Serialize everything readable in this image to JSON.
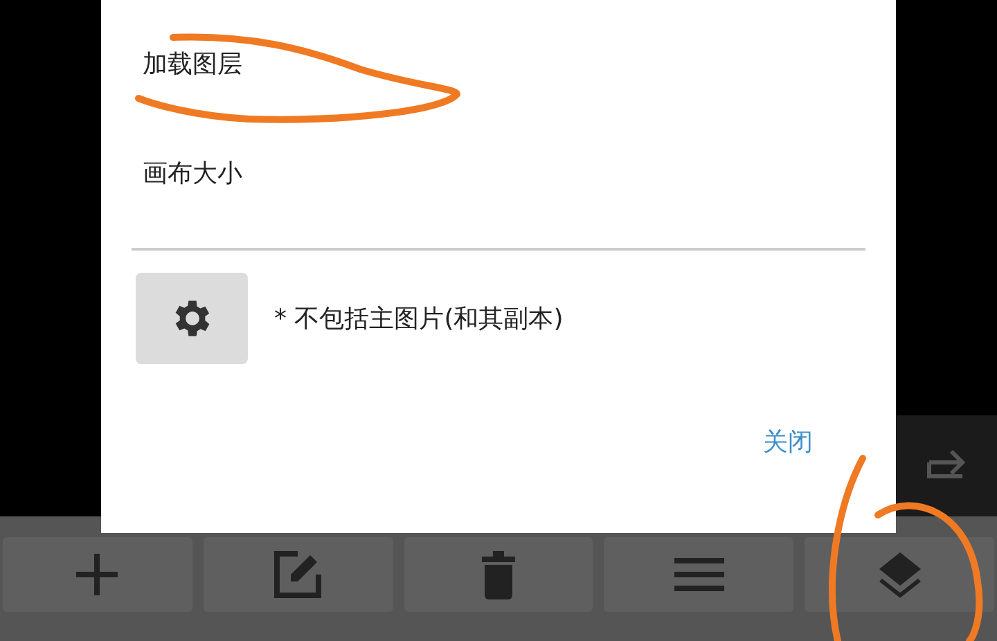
{
  "dialog": {
    "menu_items": [
      "加载图层",
      "画布大小"
    ],
    "settings_button": {
      "kind": "gear"
    },
    "note": "* 不包括主图片(和其副本)",
    "close_button": "关闭"
  },
  "side_button": {
    "kind": "redo"
  },
  "toolbar": [
    {
      "kind": "add"
    },
    {
      "kind": "edit"
    },
    {
      "kind": "delete"
    },
    {
      "kind": "menu"
    },
    {
      "kind": "layers"
    }
  ],
  "annotations": [
    {
      "color": "#f07a23"
    },
    {
      "color": "#f07a23"
    }
  ]
}
